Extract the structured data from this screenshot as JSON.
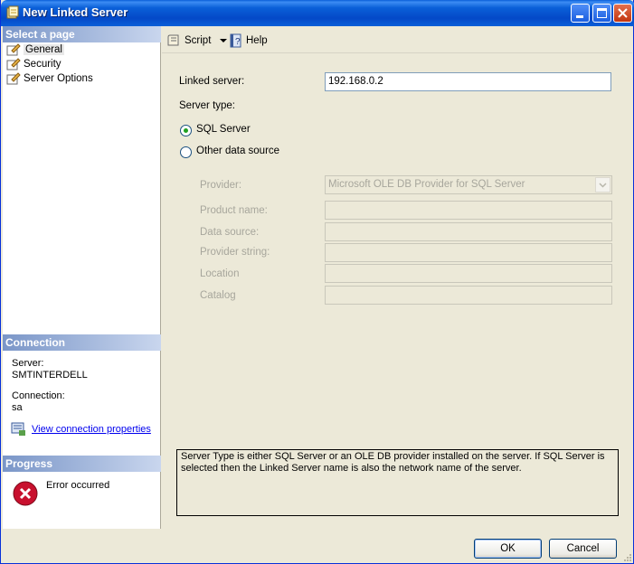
{
  "window": {
    "title": "New Linked Server"
  },
  "left": {
    "select_page_header": "Select a page",
    "pages": [
      {
        "label": "General",
        "selected": true
      },
      {
        "label": "Security",
        "selected": false
      },
      {
        "label": "Server Options",
        "selected": false
      }
    ],
    "connection_header": "Connection",
    "server_label": "Server:",
    "server_value": "SMTINTERDELL",
    "connection_label": "Connection:",
    "connection_value": "sa",
    "view_props_link": "View connection properties",
    "progress_header": "Progress",
    "progress_status": "Error occurred"
  },
  "toolbar": {
    "script_label": "Script",
    "help_label": "Help"
  },
  "form": {
    "linked_server_label": "Linked server:",
    "linked_server_value": "192.168.0.2",
    "server_type_label": "Server type:",
    "radio_sql_server": "SQL Server",
    "radio_other": "Other data source",
    "selected_server_type": "SQL Server",
    "provider_label": "Provider:",
    "provider_value": "Microsoft OLE DB Provider for SQL Server",
    "product_name_label": "Product name:",
    "data_source_label": "Data source:",
    "provider_string_label": "Provider string:",
    "location_label": "Location",
    "catalog_label": "Catalog",
    "description": "Server Type is either SQL Server or an OLE DB provider installed on the server. If SQL Server is selected then the Linked Server name is also the network name of the server."
  },
  "buttons": {
    "ok": "OK",
    "cancel": "Cancel"
  },
  "colors": {
    "titlebar": "#0a5fd8",
    "section_header": "#7a96c8",
    "error": "#c8102e",
    "link": "#0000ee"
  }
}
